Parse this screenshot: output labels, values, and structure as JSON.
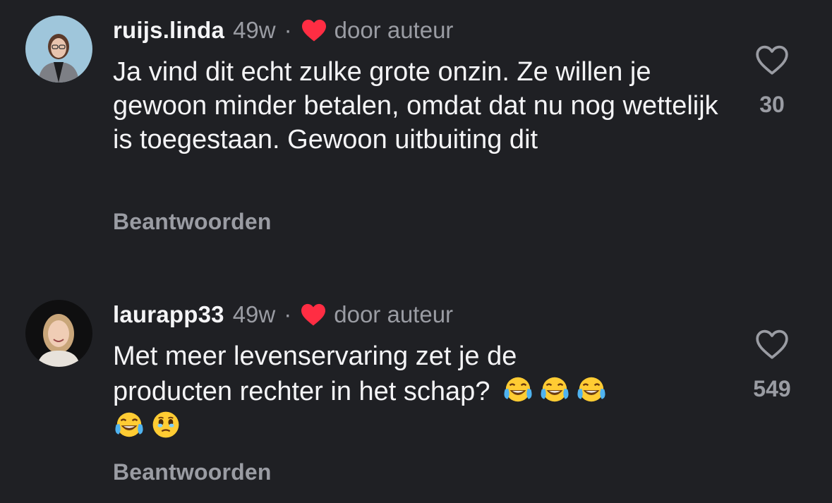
{
  "comments": [
    {
      "username": "ruijs.linda",
      "time": "49w",
      "separator": "·",
      "liked_by": "door auteur",
      "text": "Ja vind dit echt zulke grote onzin. Ze willen je gewoon minder betalen, omdat dat nu nog wettelijk is toegestaan. Gewoon uitbuiting dit",
      "likes": "30",
      "reply_label": "Beantwoorden",
      "avatar_icon": "avatar-woman-glasses"
    },
    {
      "username": "laurapp33",
      "time": "49w",
      "separator": "·",
      "liked_by": "door auteur",
      "text_line1": "Met meer levenservaring zet je de",
      "text_line2": "producten rechter in het schap?",
      "emojis_line2": [
        "tears-of-joy",
        "tears-of-joy",
        "tears-of-joy"
      ],
      "emojis_line3": [
        "tears-of-joy",
        "face-holding-back-tears"
      ],
      "likes": "549",
      "reply_label": "Beantwoorden",
      "avatar_icon": "avatar-woman-blonde"
    }
  ],
  "colors": {
    "background": "#1f2024",
    "text_primary": "#f4f4f6",
    "text_secondary": "#9a9ca3",
    "heart_red": "#ff2d43"
  }
}
